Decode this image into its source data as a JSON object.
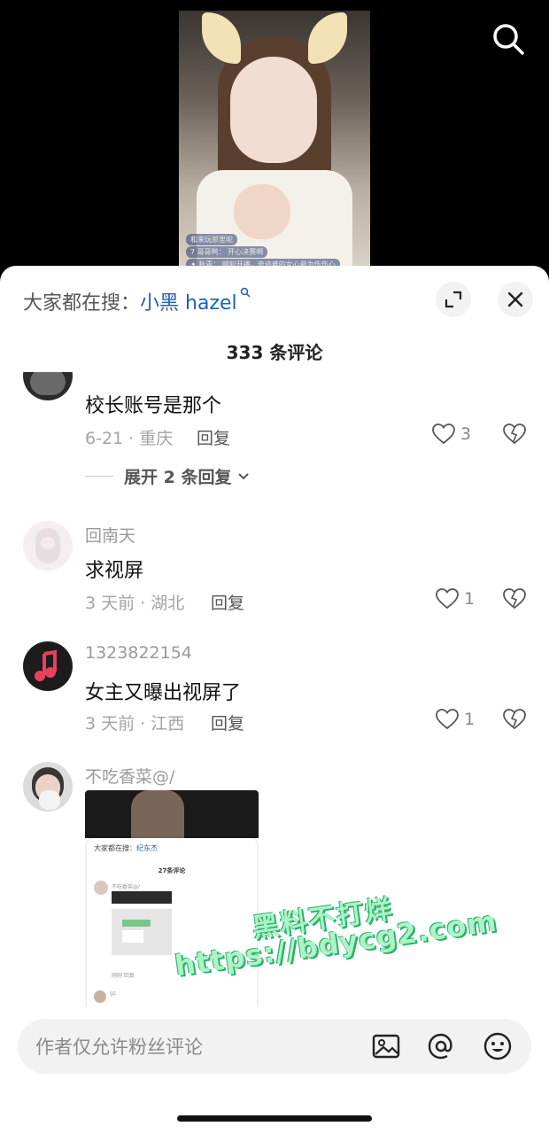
{
  "video": {
    "captions": [
      "   和来玩那里呢",
      "7 哥哥鸭： 开心决赛啊",
      "✦ 秋青： 顺利开播，奇迹难的女心最为伤伤心"
    ]
  },
  "comments_sheet": {
    "search_prefix": "大家都在搜：",
    "search_keyword": "小黑 hazel",
    "search_keyword_icon": "search-icon",
    "comment_count": "333 条评论",
    "comments": [
      {
        "text": "校长账号是那个",
        "meta": "6-21 · 重庆",
        "reply_label": "回复",
        "likes": "3",
        "expand_label": "展开 2 条回复"
      },
      {
        "username": "回南天",
        "text": "求视屏",
        "meta": "3 天前 · 湖北",
        "reply_label": "回复",
        "likes": "1"
      },
      {
        "username": "1323822154",
        "text": "女主又曝出视屏了",
        "meta": "3 天前 · 江西",
        "reply_label": "回复",
        "likes": "1"
      },
      {
        "username": "不吃香菜@/"
      }
    ],
    "embedded_screenshot": {
      "search_prefix": "大家都在搜：",
      "search_keyword": "纪东杰",
      "comment_count": "27条评论",
      "username": "不吃香菜@/",
      "meta": "刚刚  回复",
      "reply_user": "gz"
    }
  },
  "watermark": {
    "line1": "黑料不打烊",
    "line2": "https://bdycg2.com"
  },
  "input_bar": {
    "placeholder": "作者仅允许粉丝评论",
    "icons": [
      "image-icon",
      "at-icon",
      "emoji-icon"
    ]
  },
  "colors": {
    "keyword": "#1f5fb4",
    "watermark": "#aef2c8"
  }
}
